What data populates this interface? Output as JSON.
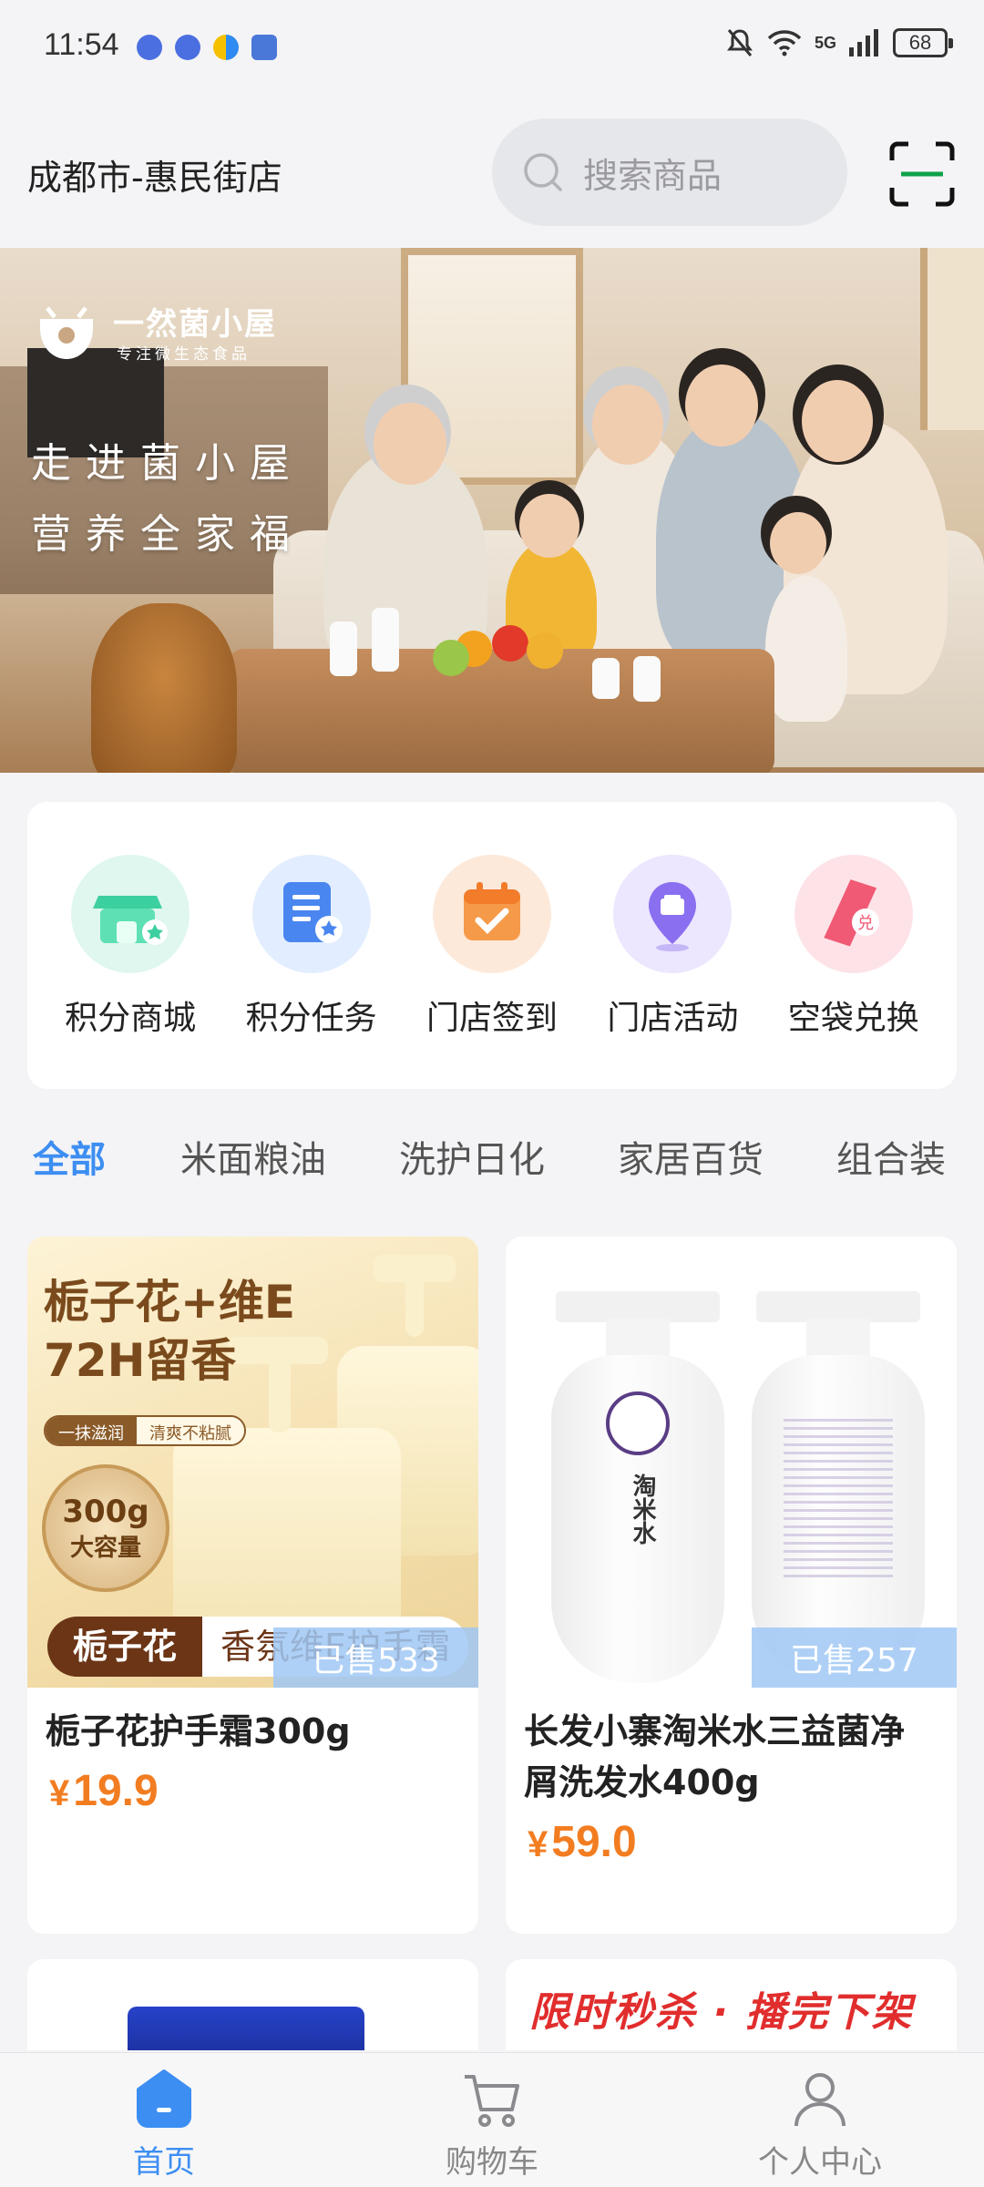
{
  "status_bar": {
    "time": "11:54",
    "network": "5G",
    "battery": "68"
  },
  "header": {
    "location": "成都市-惠民街店",
    "search_placeholder": "搜索商品"
  },
  "banner": {
    "brand_name": "一然菌小屋",
    "brand_subtitle": "专注微生态食品",
    "slogan_line1": "走进菌小屋",
    "slogan_line2": "营养全家福"
  },
  "quick_entries": [
    {
      "label": "积分商城",
      "icon": "points-mall-icon",
      "color": "#3ccf9f"
    },
    {
      "label": "积分任务",
      "icon": "points-task-icon",
      "color": "#4a86f0"
    },
    {
      "label": "门店签到",
      "icon": "store-checkin-icon",
      "color": "#f29a4a"
    },
    {
      "label": "门店活动",
      "icon": "store-activity-icon",
      "color": "#8a6ff0"
    },
    {
      "label": "空袋兑换",
      "icon": "bag-exchange-icon",
      "color": "#f0607a"
    }
  ],
  "category_tabs": [
    {
      "label": "全部",
      "active": true
    },
    {
      "label": "米面粮油",
      "active": false
    },
    {
      "label": "洗护日化",
      "active": false
    },
    {
      "label": "家居百货",
      "active": false
    },
    {
      "label": "组合装",
      "active": false
    }
  ],
  "products": [
    {
      "name": "栀子花护手霜300g",
      "price_symbol": "¥",
      "price": "19.9",
      "sold": "已售533",
      "image_text": {
        "title_line1": "栀子花+维E",
        "title_line2": "72H留香",
        "pill_left": "一抹滋润",
        "pill_right": "清爽不粘腻",
        "seal_big": "300g",
        "seal_small": "大容量",
        "tag_left": "栀子花",
        "tag_right": "香氛维E护手霜"
      }
    },
    {
      "name": "长发小寨淘米水三益菌净屑洗发水400g",
      "price_symbol": "¥",
      "price": "59.0",
      "sold": "已售257",
      "image_text": {
        "bottle_label": "淘米水"
      }
    }
  ],
  "partial_products": {
    "right_banner_text": "限时秒杀 · 播完下架"
  },
  "bottom_nav": [
    {
      "label": "首页",
      "icon": "home-icon",
      "active": true
    },
    {
      "label": "购物车",
      "icon": "cart-icon",
      "active": false
    },
    {
      "label": "个人中心",
      "icon": "profile-icon",
      "active": false
    }
  ],
  "colors": {
    "accent": "#3d8ef2",
    "price": "#f27d21",
    "scan_green": "#0ea24a"
  }
}
